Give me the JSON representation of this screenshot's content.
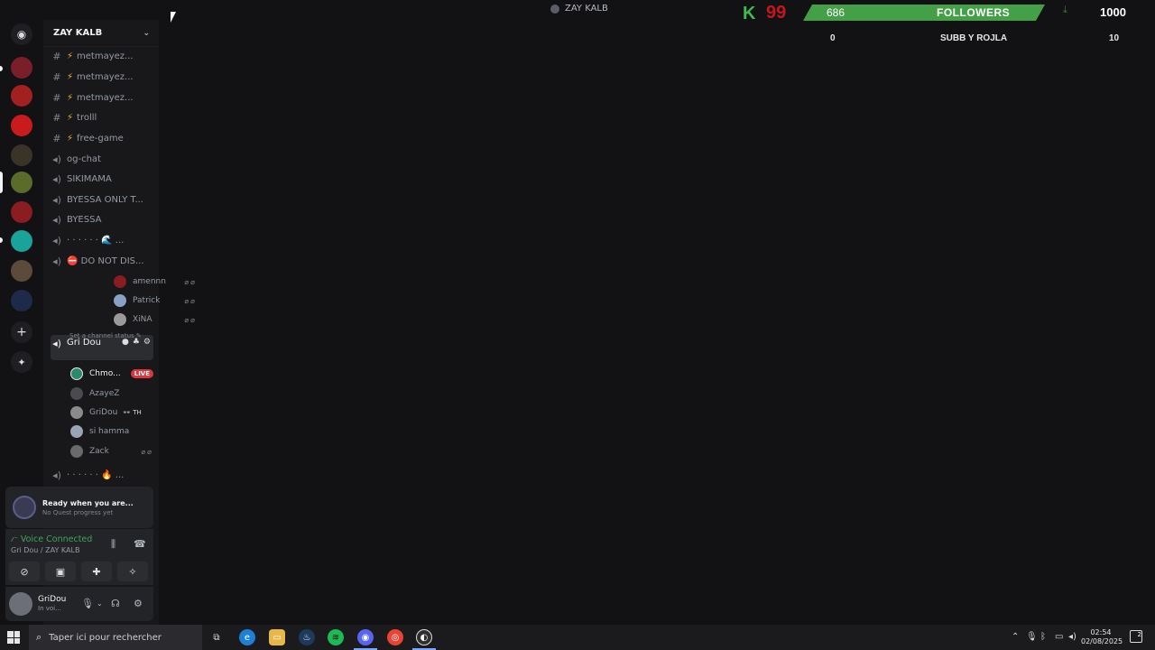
{
  "window": {
    "title": "ZAY KALB"
  },
  "server": {
    "name": "ZAY KALB"
  },
  "channels": [
    {
      "label": "metmayez...",
      "kind": "text",
      "bolt": true
    },
    {
      "label": "metmayez...",
      "kind": "text",
      "bolt": true
    },
    {
      "label": "metmayez...",
      "kind": "text",
      "bolt": true
    },
    {
      "label": "trolll",
      "kind": "text",
      "bolt": true
    },
    {
      "label": "free-game",
      "kind": "text",
      "bolt": true
    },
    {
      "label": "og-chat",
      "kind": "text",
      "bolt": false
    },
    {
      "label": "SIKIMAMA",
      "kind": "voice"
    },
    {
      "label": "BYESSA ONLY T...",
      "kind": "voice"
    },
    {
      "label": "BYESSA",
      "kind": "voice"
    },
    {
      "label": "· · · · · · 🌊 ...",
      "kind": "voice"
    },
    {
      "label": "⛔ DO NOT DIS...",
      "kind": "voice"
    }
  ],
  "voice_users_top": [
    {
      "name": "amennn",
      "muted": true
    },
    {
      "name": "Patrick",
      "muted": true
    },
    {
      "name": "XiNA",
      "muted": true
    }
  ],
  "active_channel": {
    "label": "Gri Dou",
    "status": "Set a channel status ✎"
  },
  "voice_users_active": [
    {
      "name": "Chmo...",
      "badge": "LIVE"
    },
    {
      "name": "AzayeZ"
    },
    {
      "name": "GriDou",
      "stage": "👓 TH"
    },
    {
      "name": "si hamma"
    },
    {
      "name": "Zack",
      "muted": true
    }
  ],
  "last_channel": {
    "label": "· · · · · · 🔥 ..."
  },
  "quest": {
    "title": "Ready when you are...",
    "subtitle": "No Quest progress yet"
  },
  "voice_panel": {
    "status": "Voice Connected",
    "location": "Gri Dou / ZAY KALB"
  },
  "user_panel": {
    "name": "GriDou",
    "status": "In voi..."
  },
  "overlay": {
    "k_letter": "K",
    "level": "99",
    "followers_current": "686",
    "followers_label": "FOLLOWERS",
    "followers_goal": "1000",
    "subs_current": "0",
    "subs_label": "SUBB Y ROJLA",
    "subs_goal": "10",
    "bar_color": "#43a047"
  },
  "taskbar": {
    "search_placeholder": "Taper ici pour rechercher",
    "time": "02:54",
    "date": "02/08/2025",
    "notifications": "2"
  }
}
